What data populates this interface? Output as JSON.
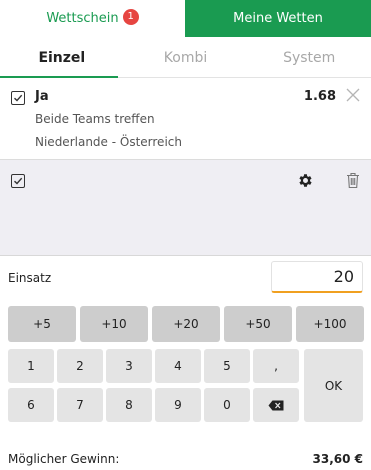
{
  "header": {
    "tabs": [
      {
        "label": "Wettschein",
        "badge": "1"
      },
      {
        "label": "Meine Wetten"
      }
    ]
  },
  "bet_type_tabs": [
    {
      "label": "Einzel",
      "active": true
    },
    {
      "label": "Kombi",
      "active": false
    },
    {
      "label": "System",
      "active": false
    }
  ],
  "bet": {
    "selection": "Ja",
    "odds": "1.68",
    "market": "Beide Teams treffen",
    "event": "Niederlande - Österreich",
    "checked": true
  },
  "options": {
    "icons": [
      "gear-icon",
      "trash-icon"
    ]
  },
  "stake": {
    "label": "Einsatz",
    "value": "20"
  },
  "quick_add": [
    "+5",
    "+10",
    "+20",
    "+50",
    "+100"
  ],
  "keypad": {
    "row1": [
      "1",
      "2",
      "3",
      "4",
      "5",
      ","
    ],
    "row2": [
      "6",
      "7",
      "8",
      "9",
      "0"
    ],
    "ok": "OK",
    "backspace_icon": "backspace-icon"
  },
  "possible_win": {
    "label": "Möglicher Gewinn:",
    "value": "33,60 €"
  },
  "colors": {
    "brand_green": "#1a9b51",
    "badge_red": "#e64541",
    "input_accent": "#f0a020"
  }
}
